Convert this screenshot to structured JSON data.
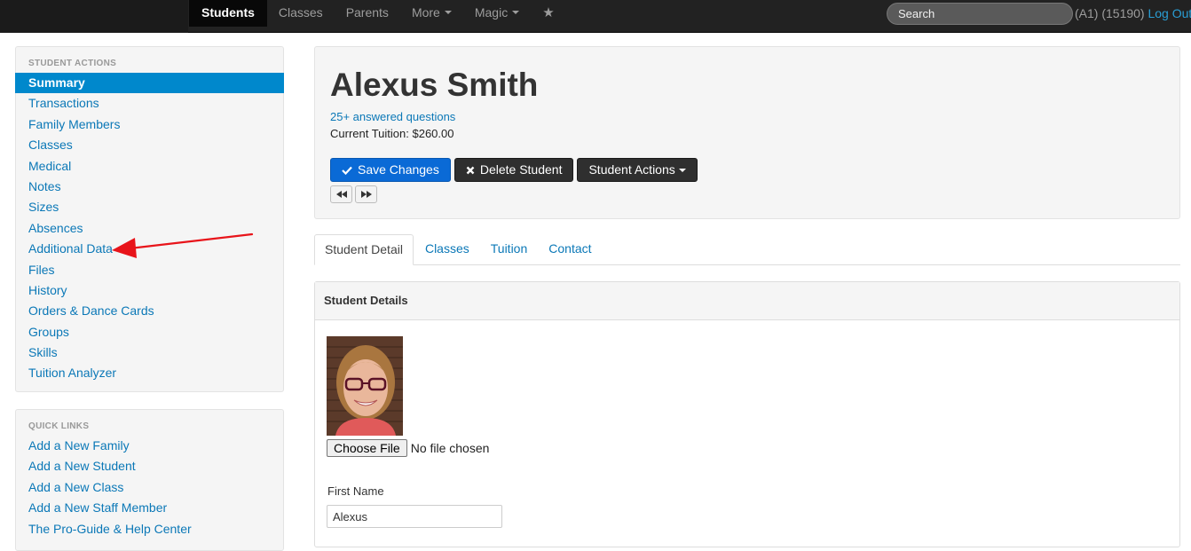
{
  "nav": {
    "items": [
      {
        "label": "Students",
        "active": true
      },
      {
        "label": "Classes"
      },
      {
        "label": "Parents"
      },
      {
        "label": "More",
        "dropdown": true
      },
      {
        "label": "Magic",
        "dropdown": true
      }
    ],
    "search_placeholder": "Search",
    "account": "(A1) (15190)",
    "logout": "Log Out"
  },
  "sidebar": {
    "student_actions": {
      "heading": "STUDENT ACTIONS",
      "items": [
        "Summary",
        "Transactions",
        "Family Members",
        "Classes",
        "Medical",
        "Notes",
        "Sizes",
        "Absences",
        "Additional Data",
        "Files",
        "History",
        "Orders & Dance Cards",
        "Groups",
        "Skills",
        "Tuition Analyzer"
      ],
      "active_index": 0
    },
    "quick_links": {
      "heading": "QUICK LINKS",
      "items": [
        "Add a New Family",
        "Add a New Student",
        "Add a New Class",
        "Add a New Staff Member",
        "The Pro-Guide & Help Center"
      ]
    }
  },
  "student": {
    "name": "Alexus Smith",
    "answered": "25+ answered questions",
    "tuition": "Current Tuition: $260.00"
  },
  "actions": {
    "save": "Save Changes",
    "delete": "Delete Student",
    "student_actions": "Student Actions"
  },
  "tabs": [
    "Student Detail",
    "Classes",
    "Tuition",
    "Contact"
  ],
  "details": {
    "heading": "Student Details",
    "choose_file": "Choose File",
    "no_file": "No file chosen",
    "first_name_label": "First Name",
    "first_name_value": "Alexus"
  },
  "colors": {
    "link": "#0b78b7",
    "active_item": "#0088cc",
    "primary_button": "#0a6ad6",
    "arrow": "#e8141a"
  }
}
